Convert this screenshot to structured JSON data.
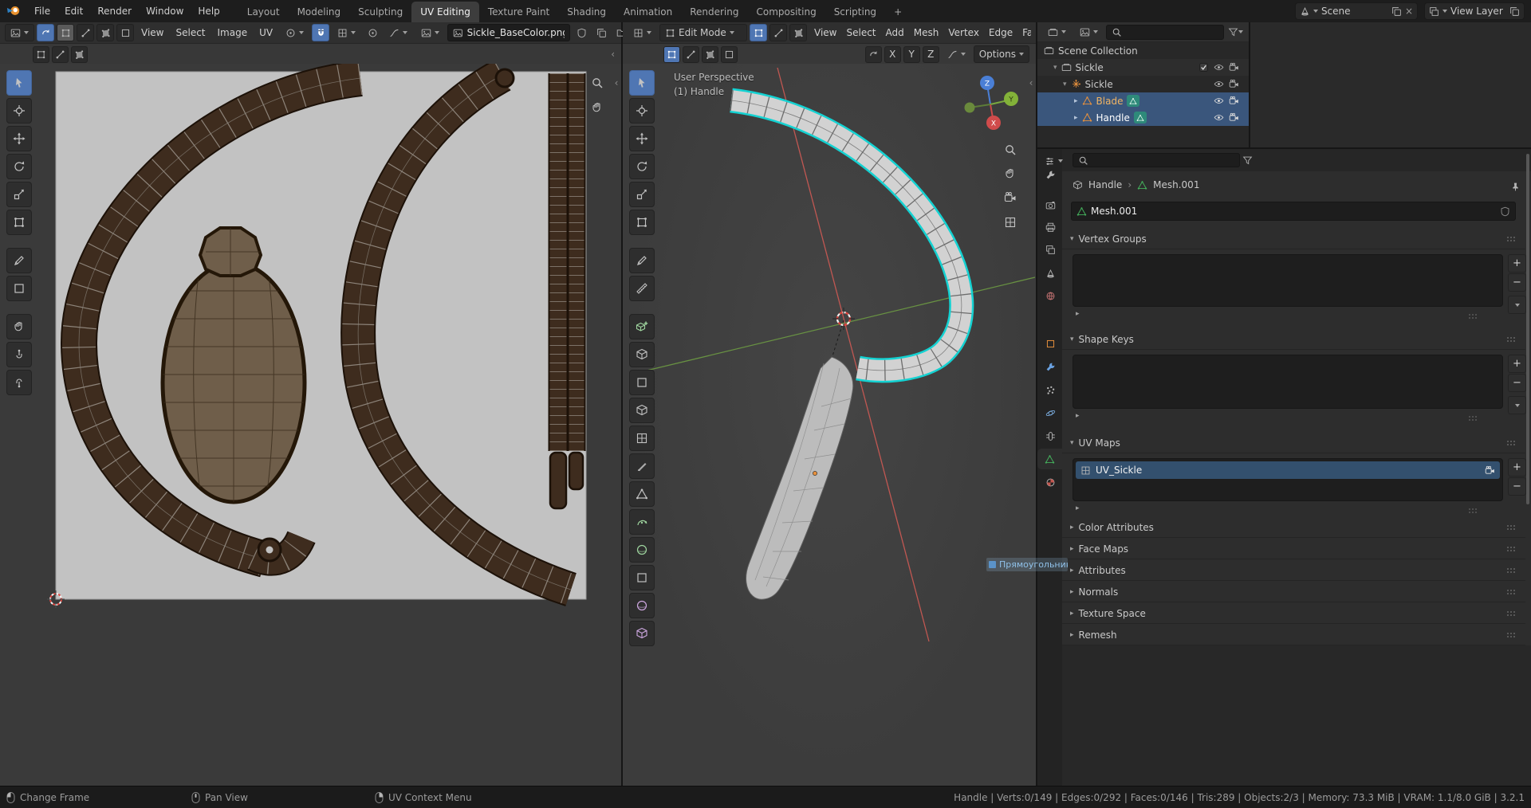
{
  "topbar": {
    "menus": [
      "File",
      "Edit",
      "Render",
      "Window",
      "Help"
    ],
    "tabs": [
      "Layout",
      "Modeling",
      "Sculpting",
      "UV Editing",
      "Texture Paint",
      "Shading",
      "Animation",
      "Rendering",
      "Compositing",
      "Scripting"
    ],
    "plus_tab": "+",
    "scene_label": "Scene",
    "view_layer_label": "View Layer"
  },
  "uv": {
    "menus": [
      "View",
      "Select",
      "Image",
      "UV"
    ],
    "image_name": "Sickle_BaseColor.png"
  },
  "view3d": {
    "mode": "Edit Mode",
    "menus": [
      "View",
      "Select",
      "Add",
      "Mesh",
      "Vertex",
      "Edge",
      "Face"
    ],
    "axes": [
      "X",
      "Y",
      "Z"
    ],
    "options": "Options",
    "overlay": {
      "line1": "User Perspective",
      "line2": "(1) Handle"
    },
    "gizmo": {
      "x": "X",
      "y": "Y",
      "z": "Z"
    }
  },
  "outliner": {
    "rows": {
      "scene_collection": "Scene Collection",
      "collection": "Sickle",
      "object": "Sickle",
      "blade": "Blade",
      "handle": "Handle"
    }
  },
  "props": {
    "breadcrumb": {
      "object": "Handle",
      "separator": "›",
      "mesh": "Mesh.001"
    },
    "name": "Mesh.001",
    "sections": {
      "vertex_groups": "Vertex Groups",
      "shape_keys": "Shape Keys",
      "uv_maps": "UV Maps",
      "closed": [
        "Color Attributes",
        "Face Maps",
        "Attributes",
        "Normals",
        "Texture Space",
        "Remesh"
      ]
    },
    "uv_map_name": "UV_Sickle"
  },
  "tooltip": "Прямоугольник",
  "status": {
    "left": [
      "Change Frame",
      "Pan View",
      "UV Context Menu"
    ],
    "right": "Handle | Verts:0/149 | Edges:0/292 | Faces:0/146 | Tris:289 | Objects:2/3 | Memory: 73.3 MiB | VRAM: 1.1/8.0 GiB | 3.2.1"
  },
  "colors": {
    "accent_blue": "#4f76b3",
    "blender_orange": "#e8913d",
    "edit_select_cyan": "#18d2d2",
    "mesh_data_green": "#44b05c",
    "uv_island_brown": "#3e2c1e"
  }
}
